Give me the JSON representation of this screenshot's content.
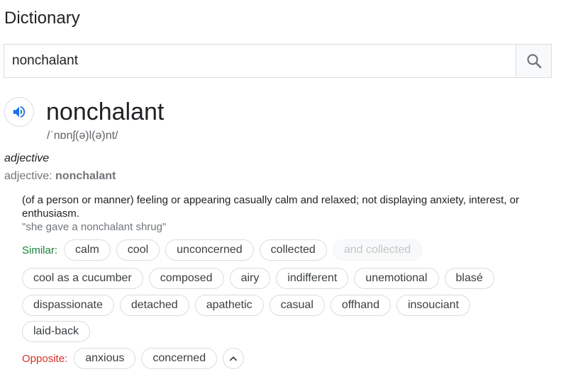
{
  "page_title": "Dictionary",
  "search": {
    "value": "nonchalant",
    "icon": "search-icon"
  },
  "entry": {
    "word": "nonchalant",
    "phonetic": "/ˈnɒnʃ(ə)l(ə)nt/",
    "part_of_speech": "adjective",
    "inflection_label": "adjective:",
    "inflection_word": "nonchalant",
    "definition": "(of a person or manner) feeling or appearing casually calm and relaxed; not displaying anxiety, interest, or enthusiasm.",
    "example": "\"she gave a nonchalant shrug\""
  },
  "similar": {
    "label": "Similar:",
    "row1": [
      "calm",
      "cool",
      "unconcerned",
      "collected",
      "and collected"
    ],
    "row2": [
      "cool as a cucumber",
      "composed",
      "airy",
      "indifferent",
      "unemotional",
      "blasé"
    ],
    "row3": [
      "dispassionate",
      "detached",
      "apathetic",
      "casual",
      "offhand",
      "insouciant"
    ],
    "row4": [
      "laid-back"
    ]
  },
  "opposite": {
    "label": "Opposite:",
    "items": [
      "anxious",
      "concerned"
    ]
  },
  "colors": {
    "similar_label": "#188038",
    "opposite_label": "#d93025",
    "speaker_blue": "#1a73e8"
  }
}
